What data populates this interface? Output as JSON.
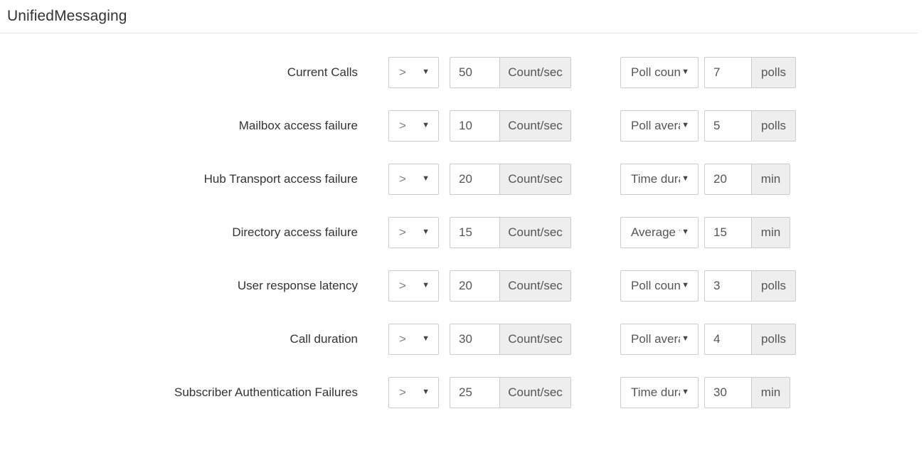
{
  "header": {
    "title": "UnifiedMessaging"
  },
  "units": {
    "count_per_sec": "Count/sec",
    "polls": "polls",
    "min": "min"
  },
  "icons": {
    "caret": "▼",
    "caret_name": "chevron-down-icon"
  },
  "rows": [
    {
      "label": "Current Calls",
      "operator": ">",
      "threshold": "50",
      "threshold_unit": "Count/sec",
      "rearm_type": "Poll count",
      "rearm_value": "7",
      "rearm_unit": "polls"
    },
    {
      "label": "Mailbox access failure",
      "operator": ">",
      "threshold": "10",
      "threshold_unit": "Count/sec",
      "rearm_type": "Poll average",
      "rearm_value": "5",
      "rearm_unit": "polls"
    },
    {
      "label": "Hub Transport access failure",
      "operator": ">",
      "threshold": "20",
      "threshold_unit": "Count/sec",
      "rearm_type": "Time duration",
      "rearm_value": "20",
      "rearm_unit": "min"
    },
    {
      "label": "Directory access failure",
      "operator": ">",
      "threshold": "15",
      "threshold_unit": "Count/sec",
      "rearm_type": "Average time",
      "rearm_value": "15",
      "rearm_unit": "min"
    },
    {
      "label": "User response latency",
      "operator": ">",
      "threshold": "20",
      "threshold_unit": "Count/sec",
      "rearm_type": "Poll count",
      "rearm_value": "3",
      "rearm_unit": "polls"
    },
    {
      "label": "Call duration",
      "operator": ">",
      "threshold": "30",
      "threshold_unit": "Count/sec",
      "rearm_type": "Poll average",
      "rearm_value": "4",
      "rearm_unit": "polls"
    },
    {
      "label": "Subscriber Authentication Failures",
      "operator": ">",
      "threshold": "25",
      "threshold_unit": "Count/sec",
      "rearm_type": "Time duration",
      "rearm_value": "30",
      "rearm_unit": "min"
    }
  ],
  "colors": {
    "border": "#cccccc",
    "addon_bg": "#eeeeee",
    "text": "#333333",
    "muted_text": "#555555",
    "divider": "#e5e5e5"
  }
}
